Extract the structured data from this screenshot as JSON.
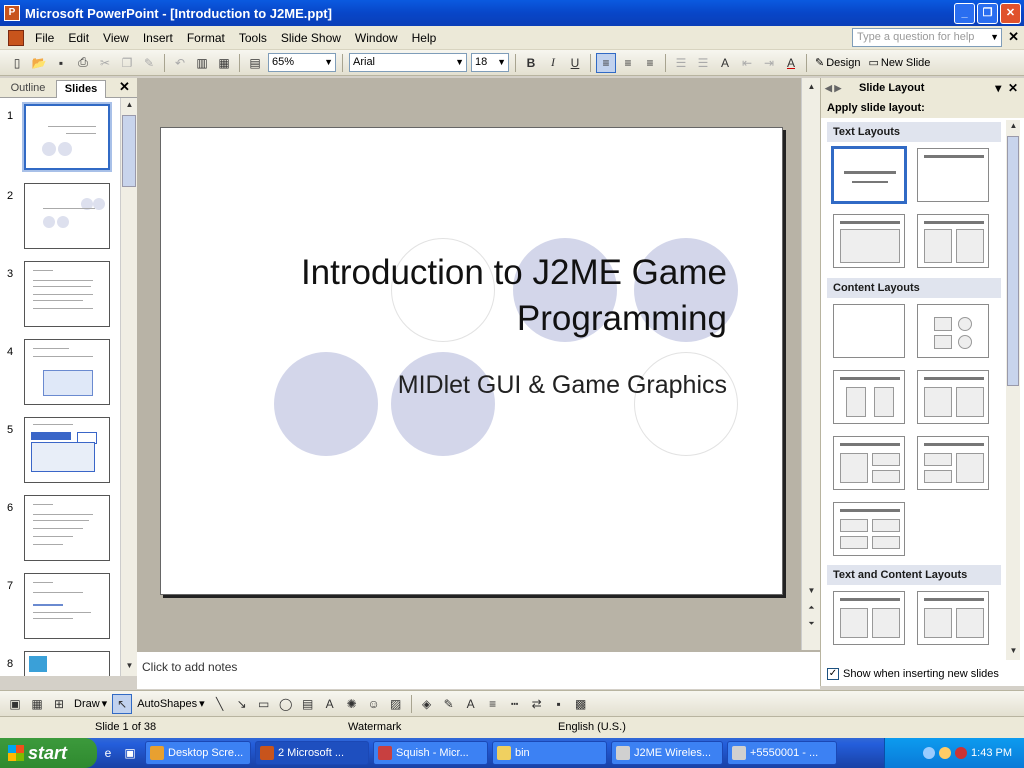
{
  "window": {
    "title": "Microsoft PowerPoint - [Introduction to J2ME.ppt]"
  },
  "menu": {
    "items": [
      "File",
      "Edit",
      "View",
      "Insert",
      "Format",
      "Tools",
      "Slide Show",
      "Window",
      "Help"
    ],
    "help_placeholder": "Type a question for help"
  },
  "toolbar": {
    "zoom": "65%",
    "font": "Arial",
    "font_size": "18",
    "bold": "B",
    "italic": "I",
    "underline": "U",
    "design_label": "Design",
    "new_slide_label": "New Slide"
  },
  "left_pane": {
    "tab_outline": "Outline",
    "tab_slides": "Slides",
    "slide_numbers": [
      "1",
      "2",
      "3",
      "4",
      "5",
      "6",
      "7",
      "8"
    ]
  },
  "slide": {
    "title": "Introduction to J2ME Game Programming",
    "title_line1": "Introduction to J2ME Game",
    "title_line2": "Programming",
    "subtitle": "MIDlet GUI & Game Graphics"
  },
  "notes": {
    "placeholder": "Click to add notes"
  },
  "task_pane": {
    "title": "Slide Layout",
    "apply_label": "Apply slide layout:",
    "sections": [
      "Text Layouts",
      "Content Layouts",
      "Text and Content Layouts"
    ],
    "checkbox_label": "Show when inserting new slides",
    "checkbox_checked": true
  },
  "draw_toolbar": {
    "draw_label": "Draw",
    "autoshapes_label": "AutoShapes"
  },
  "status": {
    "slide_indicator": "Slide 1 of 38",
    "design": "Watermark",
    "language": "English (U.S.)"
  },
  "taskbar": {
    "start_label": "start",
    "items": [
      "Desktop Scre...",
      "2 Microsoft ...",
      "Squish - Micr...",
      "bin",
      "J2ME Wireles...",
      "+5550001 - ..."
    ],
    "clock": "1:43 PM"
  },
  "colors": {
    "title_bar": "#0a4fd8",
    "taskbar": "#245edb",
    "start": "#2f8a2f",
    "slide_circle": "#d3d6ea",
    "selection": "#316ac5"
  }
}
